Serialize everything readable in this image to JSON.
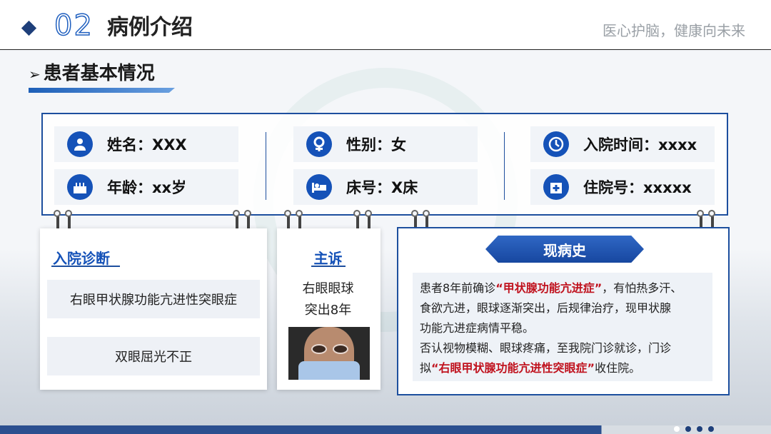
{
  "header": {
    "section_number": "02",
    "section_title": "病例介绍",
    "slogan": "医心护脑，健康向未来"
  },
  "subheading": "患者基本情况",
  "info": {
    "name": "姓名：XXX",
    "gender": "性别：女",
    "admission_time": "入院时间：xxxx",
    "age": "年龄：xx岁",
    "bed": "床号：X床",
    "admission_no": "住院号：xxxxx"
  },
  "diagnosis": {
    "title": "入院诊断",
    "items": [
      "右眼甲状腺功能亢进性突眼症",
      "双眼屈光不正"
    ]
  },
  "chief_complaint": {
    "title": "主诉",
    "line1": "右眼眼球",
    "line2": "突出8年"
  },
  "history": {
    "title": "现病史",
    "p1_a": "患者8年前确诊",
    "p1_hl": "“甲状腺功能亢进症”",
    "p1_b": "，有怕热多汗、",
    "p2": "食欲亢进，眼球逐渐突出，后规律治疗，现甲状腺",
    "p3": "功能亢进症病情平稳。",
    "p4": "否认视物模糊、眼球疼痛，至我院门诊就诊，门诊",
    "p5_a": "拟",
    "p5_hl": "“右眼甲状腺功能亢进性突眼症”",
    "p5_b": "收住院。"
  },
  "icons": {
    "name": "user-icon",
    "gender": "female-icon",
    "admission_time": "clock-icon",
    "age": "birthday-cake-icon",
    "bed": "bed-icon",
    "admission_no": "hospital-icon"
  },
  "colors": {
    "accent": "#1552b8",
    "highlight": "#c0121e",
    "frame": "#1d4f9e"
  }
}
